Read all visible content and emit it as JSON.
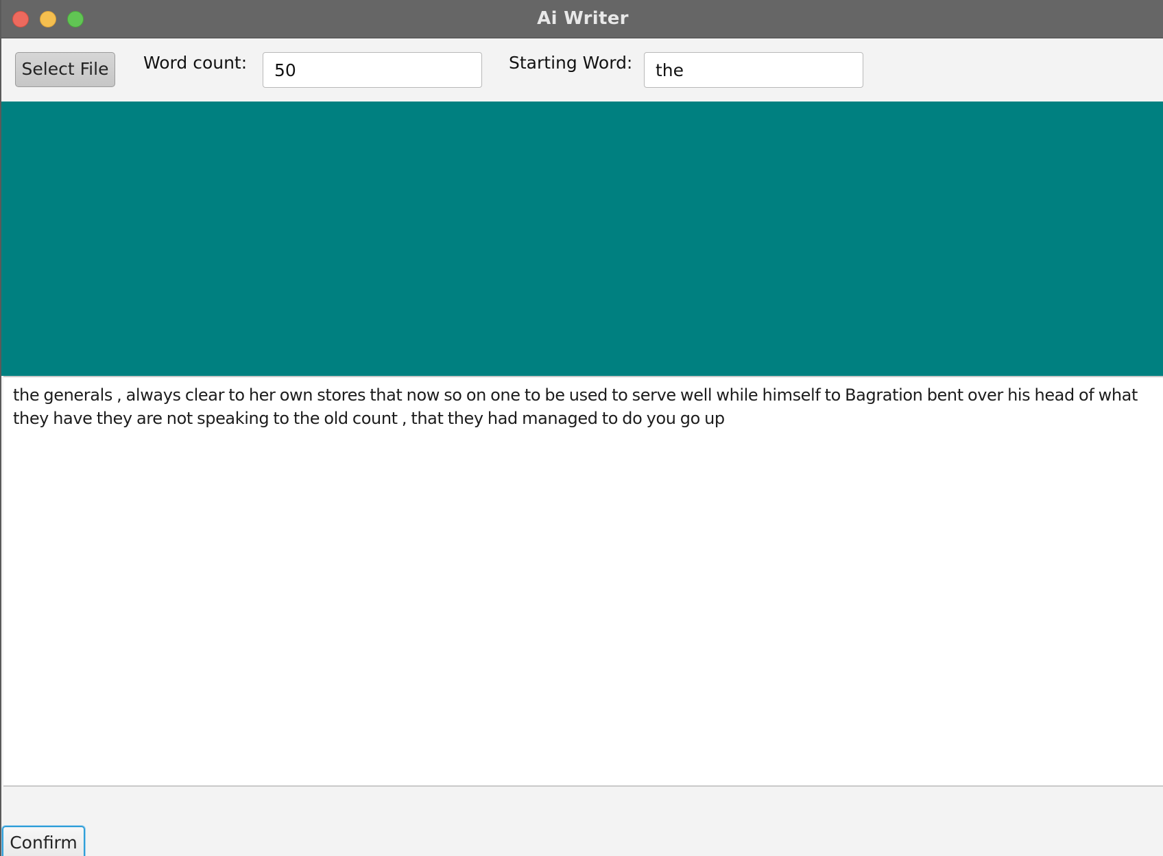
{
  "window": {
    "title": "Ai Writer",
    "controls": [
      "close-icon",
      "minimize-icon",
      "zoom-icon"
    ]
  },
  "toolbar": {
    "select_file_label": "Select File",
    "word_count_label": "Word count:",
    "word_count_value": "50",
    "starting_word_label": "Starting Word:",
    "starting_word_value": "the"
  },
  "panel": {
    "color": "#008080"
  },
  "output": {
    "text": "the generals , always clear to her own stores that now so on one to be used to serve well while himself to Bagration bent over his head of what they have they are not speaking to the old count , that they had managed to do you go up"
  },
  "footer": {
    "confirm_label": "Confirm"
  }
}
